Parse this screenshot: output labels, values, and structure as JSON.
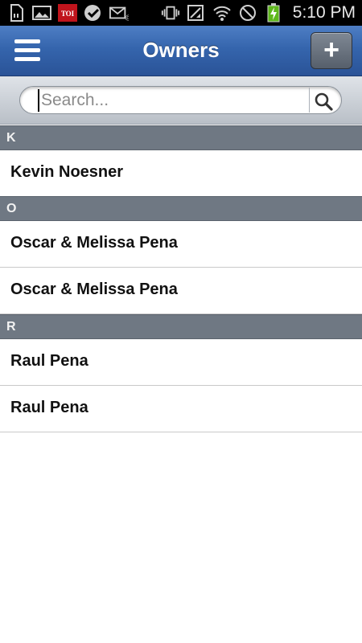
{
  "status_bar": {
    "time": "5:10 PM",
    "left_icons": [
      "sd-card-icon",
      "gallery-icon",
      "toi-app-icon",
      "check-badge-icon",
      "email-icon"
    ],
    "right_icons": [
      "vibrate-icon",
      "no-signal-icon",
      "wifi-icon",
      "blocked-icon",
      "battery-charging-icon"
    ]
  },
  "header": {
    "title": "Owners",
    "add_label": "+"
  },
  "search": {
    "placeholder": "Search..."
  },
  "sections": [
    {
      "letter": "K",
      "items": [
        "Kevin Noesner"
      ]
    },
    {
      "letter": "O",
      "items": [
        "Oscar & Melissa Pena",
        "Oscar & Melissa Pena"
      ]
    },
    {
      "letter": "R",
      "items": [
        "Raul Pena",
        "Raul Pena"
      ]
    }
  ],
  "colors": {
    "header_blue": "#3565ad",
    "section_gray": "#6f7883"
  }
}
